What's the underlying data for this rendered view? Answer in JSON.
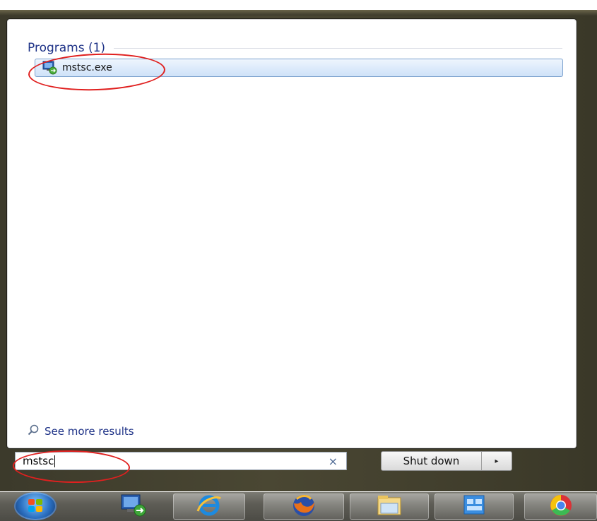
{
  "start_menu": {
    "section_title": "Programs (1)",
    "result": {
      "label": "mstsc.exe",
      "icon": "remote-desktop-icon"
    },
    "see_more_label": "See more results",
    "search": {
      "value": "mstsc",
      "clear_icon": "×"
    },
    "shutdown": {
      "label": "Shut down",
      "arrow": "▸"
    }
  },
  "taskbar": {
    "items": [
      {
        "name": "start-orb",
        "icon": "windows-logo-icon"
      },
      {
        "name": "remote-desktop",
        "icon": "remote-desktop-icon"
      },
      {
        "name": "internet-explorer",
        "icon": "ie-icon"
      },
      {
        "name": "firefox",
        "icon": "firefox-icon"
      },
      {
        "name": "file-explorer",
        "icon": "folder-icon"
      },
      {
        "name": "control-panel",
        "icon": "control-panel-icon"
      },
      {
        "name": "chrome",
        "icon": "chrome-icon"
      }
    ]
  },
  "colors": {
    "accent_link": "#1e3287",
    "annotation": "#e0201f",
    "selection": "#dceafb"
  }
}
